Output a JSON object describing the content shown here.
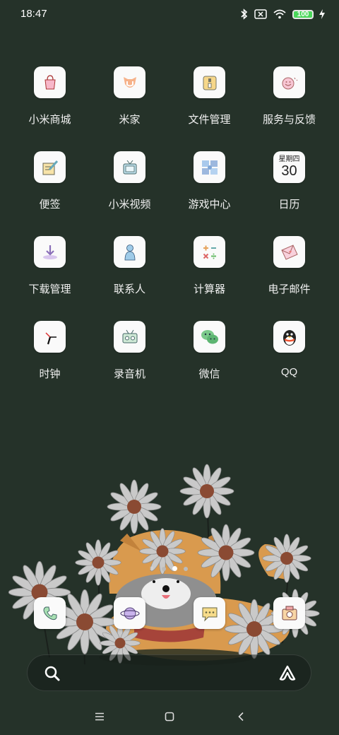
{
  "status": {
    "time": "18:47",
    "battery": "100"
  },
  "apps": [
    {
      "label": "小米商城",
      "icon": "mi-store-icon"
    },
    {
      "label": "米家",
      "icon": "mijia-icon"
    },
    {
      "label": "文件管理",
      "icon": "file-manager-icon"
    },
    {
      "label": "服务与反馈",
      "icon": "service-feedback-icon"
    },
    {
      "label": "便签",
      "icon": "notes-icon"
    },
    {
      "label": "小米视频",
      "icon": "mi-video-icon"
    },
    {
      "label": "游戏中心",
      "icon": "game-center-icon"
    },
    {
      "label": "日历",
      "icon": "calendar-icon",
      "calendar_weekday": "星期四",
      "calendar_day": "30"
    },
    {
      "label": "下载管理",
      "icon": "downloads-icon"
    },
    {
      "label": "联系人",
      "icon": "contacts-icon"
    },
    {
      "label": "计算器",
      "icon": "calculator-icon"
    },
    {
      "label": "电子邮件",
      "icon": "email-icon"
    },
    {
      "label": "时钟",
      "icon": "clock-icon"
    },
    {
      "label": "录音机",
      "icon": "recorder-icon"
    },
    {
      "label": "微信",
      "icon": "wechat-icon"
    },
    {
      "label": "QQ",
      "icon": "qq-icon"
    }
  ],
  "dock": [
    {
      "icon": "phone-icon"
    },
    {
      "icon": "browser-icon"
    },
    {
      "icon": "messages-icon"
    },
    {
      "icon": "camera-icon"
    }
  ],
  "page_indicator": {
    "count": 4,
    "active": 2
  },
  "colors": {
    "background": "#253229",
    "tile": "#fafafa",
    "battery": "#4ad65a"
  }
}
